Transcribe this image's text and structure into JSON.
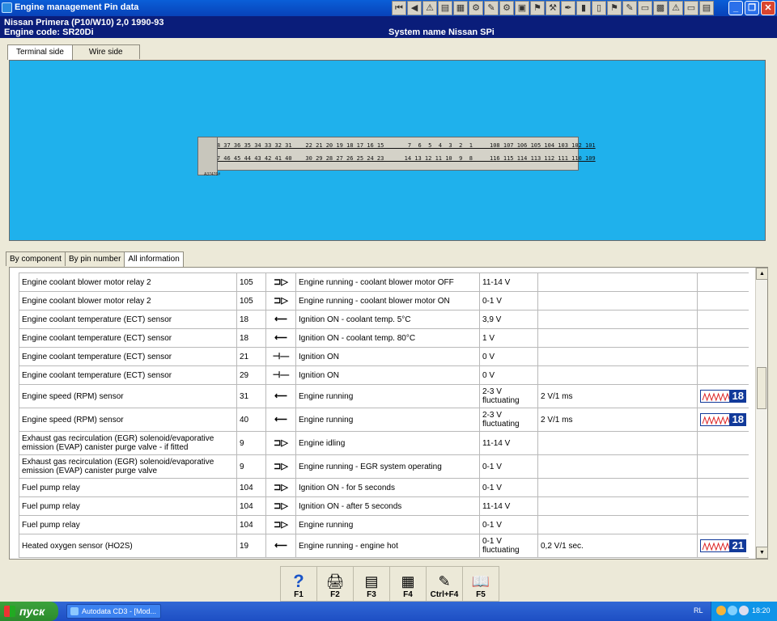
{
  "window": {
    "title": "Engine management Pin data",
    "toolbar_icons": [
      "first-icon",
      "prev-icon",
      "warning-icon",
      "doc-icon",
      "chart-icon",
      "gear-icon",
      "tool-icon",
      "settings-icon",
      "id-icon",
      "flag-icon",
      "tool2-icon",
      "pen-icon",
      "bag-icon",
      "book-icon",
      "tool3-icon",
      "tool4-icon",
      "car-icon",
      "map-icon",
      "alert-icon",
      "car2-icon",
      "print-icon"
    ],
    "toolbar_glyphs": [
      "⏮",
      "◀",
      "⚠",
      "▤",
      "▦",
      "⚙",
      "✎",
      "⚙",
      "▣",
      "⚑",
      "⚒",
      "✒",
      "▮",
      "▯",
      "⚑",
      "✎",
      "▭",
      "▩",
      "⚠",
      "▭",
      "▤"
    ]
  },
  "info": {
    "vehicle": "Nissan   Primera (P10/W10) 2,0  1990-93",
    "engine_code": "Engine code: SR20Di",
    "system_name": "System name Nissan SPi"
  },
  "view_tabs": [
    "Terminal side",
    "Wire side"
  ],
  "connector": {
    "row1": "39 38 37 36 35 34 33 32 31    22 21 20 19 18 17 16 15       7  6  5  4  3  2  1     108 107 106 105 104 103 102 101",
    "row2": "48 47 46 45 44 43 42 41 40    30 29 28 27 26 25 24 23      14 13 12 11 10  9  8     116 115 114 113 112 111 110 109",
    "code": "A37476#"
  },
  "list_tabs": [
    "By component",
    "By pin number",
    "All information"
  ],
  "rows": [
    {
      "component": "Engine coolant blower motor relay 2",
      "pin": "105",
      "dir": "out",
      "condition": "Engine running - coolant blower motor OFF",
      "value": "11-14 V",
      "measure": "",
      "wave": ""
    },
    {
      "component": "Engine coolant blower motor relay 2",
      "pin": "105",
      "dir": "out",
      "condition": "Engine running - coolant blower motor ON",
      "value": "0-1 V",
      "measure": "",
      "wave": ""
    },
    {
      "component": "Engine coolant temperature (ECT) sensor",
      "pin": "18",
      "dir": "in",
      "condition": "Ignition ON - coolant temp. 5°C",
      "value": "3,9 V",
      "measure": "",
      "wave": ""
    },
    {
      "component": "Engine coolant temperature (ECT) sensor",
      "pin": "18",
      "dir": "in",
      "condition": "Ignition ON - coolant temp. 80°C",
      "value": "1 V",
      "measure": "",
      "wave": ""
    },
    {
      "component": "Engine coolant temperature (ECT) sensor",
      "pin": "21",
      "dir": "ground",
      "condition": "Ignition ON",
      "value": "0 V",
      "measure": "",
      "wave": ""
    },
    {
      "component": "Engine coolant temperature (ECT) sensor",
      "pin": "29",
      "dir": "ground",
      "condition": "Ignition ON",
      "value": "0 V",
      "measure": "",
      "wave": ""
    },
    {
      "component": "Engine speed (RPM) sensor",
      "pin": "31",
      "dir": "in",
      "condition": "Engine running",
      "value": "2-3 V fluctuating",
      "measure": "2 V/1 ms",
      "wave": "18"
    },
    {
      "component": "Engine speed (RPM) sensor",
      "pin": "40",
      "dir": "in",
      "condition": "Engine running",
      "value": "2-3 V fluctuating",
      "measure": "2 V/1 ms",
      "wave": "18"
    },
    {
      "component": "Exhaust gas recirculation (EGR) solenoid/evaporative emission (EVAP) canister purge valve - if fitted",
      "pin": "9",
      "dir": "out",
      "condition": "Engine idling",
      "value": "11-14 V",
      "measure": "",
      "wave": ""
    },
    {
      "component": "Exhaust gas recirculation (EGR) solenoid/evaporative emission (EVAP) canister purge valve",
      "pin": "9",
      "dir": "out",
      "condition": "Engine running - EGR system operating",
      "value": "0-1 V",
      "measure": "",
      "wave": ""
    },
    {
      "component": "Fuel pump relay",
      "pin": "104",
      "dir": "out",
      "condition": "Ignition ON - for 5 seconds",
      "value": "0-1 V",
      "measure": "",
      "wave": ""
    },
    {
      "component": "Fuel pump relay",
      "pin": "104",
      "dir": "out",
      "condition": "Ignition ON - after 5 seconds",
      "value": "11-14 V",
      "measure": "",
      "wave": ""
    },
    {
      "component": "Fuel pump relay",
      "pin": "104",
      "dir": "out",
      "condition": "Engine running",
      "value": "0-1 V",
      "measure": "",
      "wave": ""
    },
    {
      "component": "Heated oxygen sensor (HO2S)",
      "pin": "19",
      "dir": "in",
      "condition": "Engine running - engine hot",
      "value": "0-1 V fluctuating",
      "measure": "0,2 V/1 sec.",
      "wave": "21"
    }
  ],
  "dir_glyphs": {
    "out": "⊐▷",
    "in": "⟵",
    "ground": "⊣―"
  },
  "fkeys": [
    {
      "label": "F1",
      "icon": "help-icon",
      "glyph": "?"
    },
    {
      "label": "F2",
      "icon": "printer-icon",
      "glyph": "🖨"
    },
    {
      "label": "F3",
      "icon": "copy-icon",
      "glyph": "▤"
    },
    {
      "label": "F4",
      "icon": "copy-all-icon",
      "glyph": "▦"
    },
    {
      "label": "Ctrl+F4",
      "icon": "notepad-icon",
      "glyph": "✎"
    },
    {
      "label": "F5",
      "icon": "book-icon",
      "glyph": "📖"
    }
  ],
  "taskbar": {
    "start": "пуск",
    "task": "Autodata CD3 - [Mod...",
    "lang": "RL",
    "clock": "18:20"
  },
  "colors": {
    "titlebar": "#0842b8",
    "infobar": "#0a1d7a",
    "connector_bg": "#1fb1ec",
    "wave_badge": "#123a9a"
  }
}
